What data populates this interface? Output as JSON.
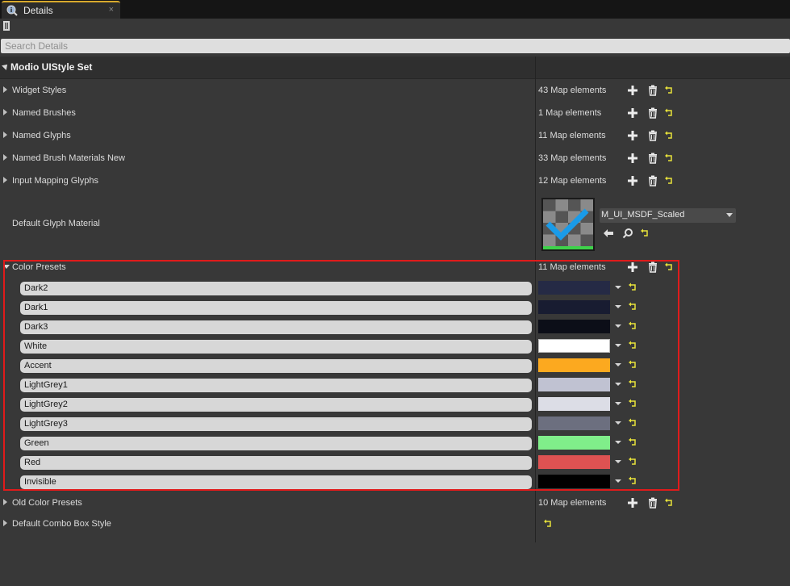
{
  "tab": {
    "title": "Details",
    "close": "×"
  },
  "search": {
    "placeholder": "Search Details"
  },
  "category": {
    "title": "Modio UIStyle Set"
  },
  "properties": [
    {
      "label": "Widget Styles",
      "value": "43 Map elements"
    },
    {
      "label": "Named Brushes",
      "value": "1 Map elements"
    },
    {
      "label": "Named Glyphs",
      "value": "11 Map elements"
    },
    {
      "label": "Named Brush Materials New",
      "value": "33 Map elements"
    },
    {
      "label": "Input Mapping Glyphs",
      "value": "12 Map elements"
    }
  ],
  "default_glyph_material": {
    "label": "Default Glyph Material",
    "asset": "M_UI_MSDF_Scaled"
  },
  "color_presets": {
    "label": "Color Presets",
    "value": "11 Map elements",
    "items": [
      {
        "key": "Dark2",
        "color": "#252a45"
      },
      {
        "key": "Dark1",
        "color": "#181c31"
      },
      {
        "key": "Dark3",
        "color": "#0c0e18"
      },
      {
        "key": "White",
        "color": "#ffffff"
      },
      {
        "key": "Accent",
        "color": "#fca91f"
      },
      {
        "key": "LightGrey1",
        "color": "#c0c2d2"
      },
      {
        "key": "LightGrey2",
        "color": "#dcdde6"
      },
      {
        "key": "LightGrey3",
        "color": "#6c6f7f"
      },
      {
        "key": "Green",
        "color": "#80ee8a"
      },
      {
        "key": "Red",
        "color": "#de5252"
      },
      {
        "key": "Invisible",
        "color": "#000000"
      }
    ]
  },
  "old_color_presets": {
    "label": "Old Color Presets",
    "value": "10 Map elements"
  },
  "default_combo_box_style": {
    "label": "Default Combo Box Style"
  },
  "colors": {
    "highlight_border": "#e01b1b",
    "reset_arrow": "#e8e23a",
    "tab_accent": "#d8a92c"
  },
  "icons": {
    "add": "plus-icon",
    "delete": "trash-icon",
    "reset": "reset-to-default-icon",
    "browse": "use-selected-arrow-icon",
    "find": "magnifier-icon",
    "lock": "lock-icon"
  }
}
